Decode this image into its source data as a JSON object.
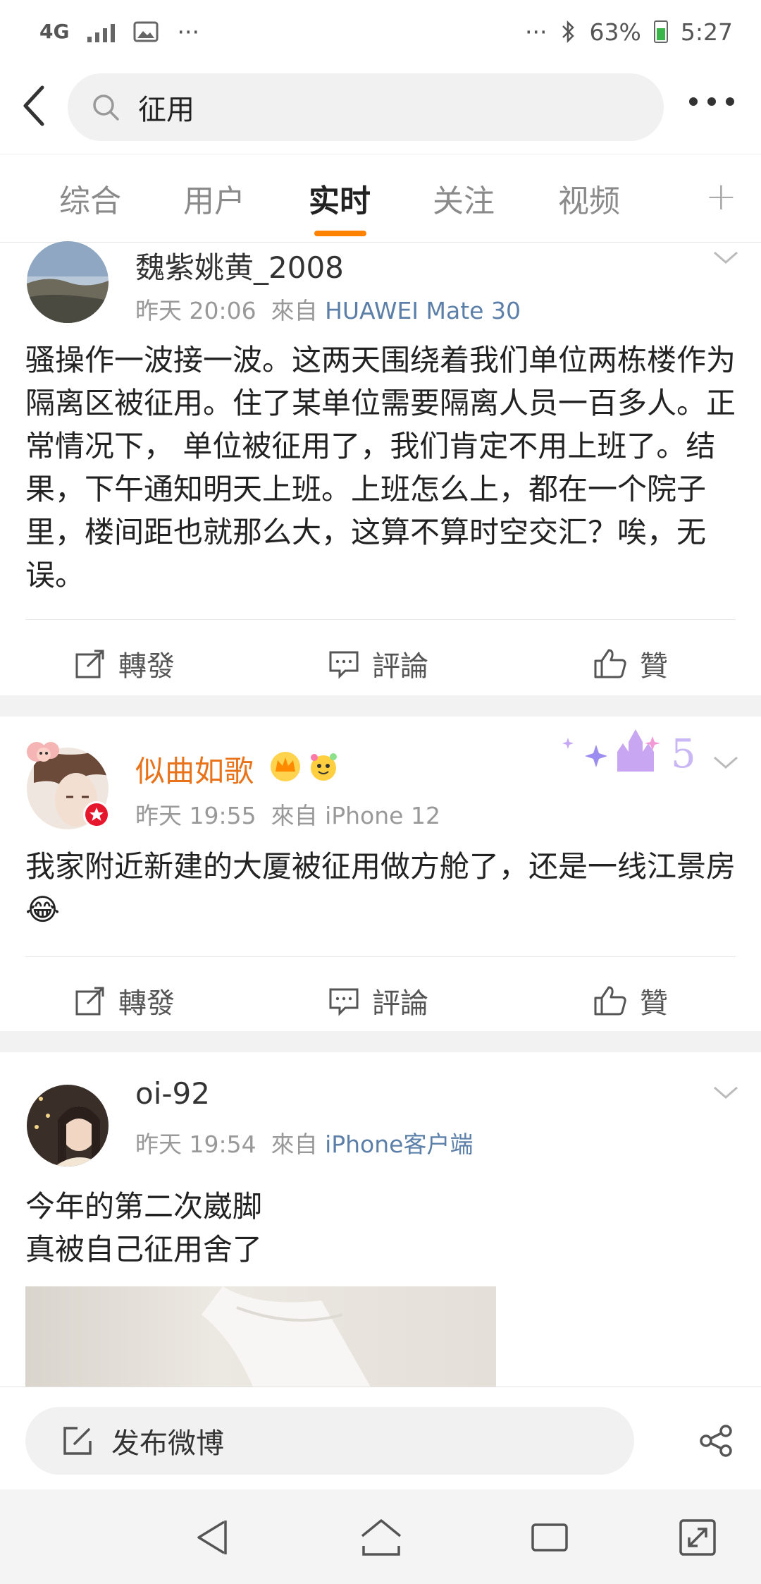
{
  "status_bar": {
    "network": "4G",
    "battery": "63%",
    "time": "5:27",
    "dots_left": "···",
    "dots_right": "···",
    "icons": [
      "signal-icon",
      "image-icon",
      "bluetooth-icon",
      "battery-icon"
    ]
  },
  "search": {
    "query": "征用"
  },
  "tabs": [
    {
      "label": "综合",
      "active": false
    },
    {
      "label": "用户",
      "active": false
    },
    {
      "label": "实时",
      "active": true
    },
    {
      "label": "关注",
      "active": false
    },
    {
      "label": "视频",
      "active": false
    }
  ],
  "tabs_plus": "+",
  "accent_color": "#ff8200",
  "posts": [
    {
      "username": "魏紫姚黄_2008",
      "time": "昨天 20:06",
      "source_prefix": "來自",
      "source": "HUAWEI Mate 30",
      "text": "骚操作一波接一波。这两天围绕着我们单位两栋楼作为隔离区被征用。住了某单位需要隔离人员一百多人。正常情况下， 单位被征用了，我们肯定不用上班了。结果，下午通知明天上班。上班怎么上，都在一个院子里，楼间距也就那么大，这算不算时空交汇？唉，无误。",
      "actions": {
        "repost": "轉發",
        "comment": "評論",
        "like": "贊"
      }
    },
    {
      "username": "似曲如歌",
      "username_color": "#e8731a",
      "time": "昨天 19:55",
      "source_prefix": "來自",
      "source": "iPhone 12",
      "text": "我家附近新建的大厦被征用做方舱了，还是一线江景房😂",
      "actions": {
        "repost": "轉發",
        "comment": "評論",
        "like": "贊"
      }
    },
    {
      "username": "oi-92",
      "time": "昨天 19:54",
      "source_prefix": "來自",
      "source": "iPhone客户端",
      "text_line1": "今年的第二次崴脚",
      "text_line2": "真被自己征用舍了"
    }
  ],
  "compose": {
    "label": "发布微博"
  }
}
